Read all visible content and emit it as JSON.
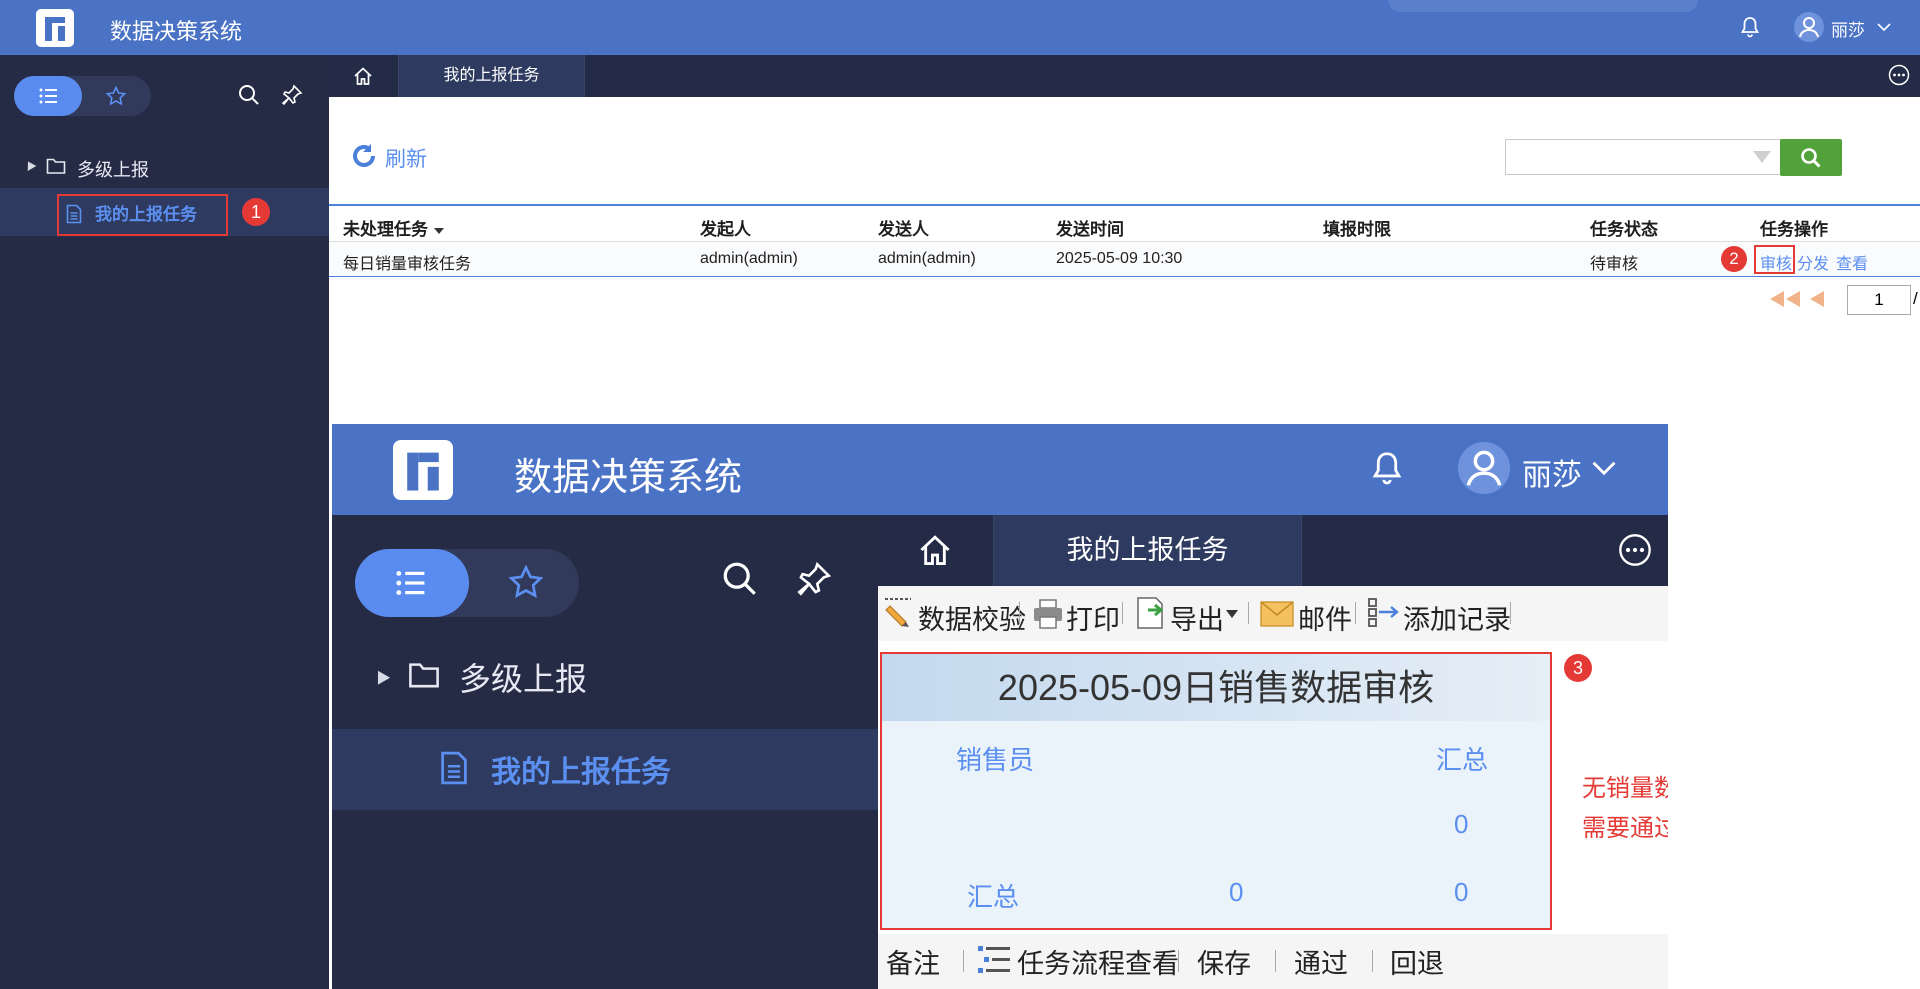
{
  "app": {
    "title": "数据决策系统",
    "user": "丽莎"
  },
  "sidebar": {
    "tree_parent": "多级上报",
    "tree_child": "我的上报任务"
  },
  "tabs": {
    "active": "我的上报任务"
  },
  "toolbar": {
    "refresh": "刷新"
  },
  "table": {
    "headers": [
      "未处理任务",
      "发起人",
      "发送人",
      "发送时间",
      "填报时限",
      "任务状态",
      "任务操作"
    ],
    "rows": [
      {
        "task": "每日销量审核任务",
        "initiator": "admin(admin)",
        "sender": "admin(admin)",
        "sent_time": "2025-05-09 10:30",
        "deadline": "",
        "status": "待审核",
        "actions": [
          "审核",
          "分发",
          "查看"
        ]
      }
    ]
  },
  "pagination": {
    "page": "1",
    "slash": "/"
  },
  "badges": [
    "1",
    "2",
    "3"
  ],
  "inset": {
    "app_title": "数据决策系统",
    "user": "丽莎",
    "tree_parent": "多级上报",
    "tree_child": "我的上报任务",
    "tab": "我的上报任务",
    "toolbar": [
      "数据校验",
      "打印",
      "导出",
      "邮件",
      "添加记录"
    ],
    "report": {
      "title": "2025-05-09日销售数据审核",
      "col_salesperson": "销售员",
      "col_total": "汇总",
      "row1_total": "0",
      "sum_label": "汇总",
      "sum_value": "0",
      "sum_total": "0"
    },
    "bottom": [
      "备注",
      "任务流程查看",
      "保存",
      "通过",
      "回退"
    ]
  },
  "annotation": {
    "line1": "无销量数据",
    "line2": "需要通过分发任务收集数据"
  },
  "colors": {
    "brand": "#4a72c5",
    "accent": "#5b8ff0",
    "dark": "#252b45",
    "highlight": "#e53935",
    "search": "#52a23c"
  }
}
